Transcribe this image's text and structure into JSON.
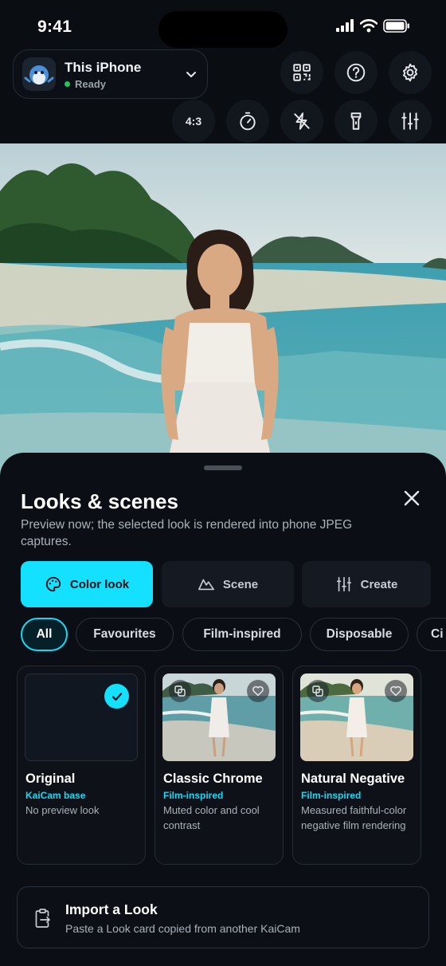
{
  "status": {
    "time": "9:41"
  },
  "device": {
    "name": "This iPhone",
    "status": "Ready"
  },
  "toolbar": {
    "ratio": "4:3"
  },
  "icons": [
    "qr-code-icon",
    "help-icon",
    "gear-icon",
    "timer-icon",
    "flash-off-icon",
    "flashlight-icon",
    "sliders-icon",
    "grid-icon"
  ],
  "sheet": {
    "title": "Looks & scenes",
    "description": "Preview now; the selected look is rendered into phone JPEG captures.",
    "tabs": [
      {
        "label": "Color look",
        "icon": "palette-icon",
        "active": true
      },
      {
        "label": "Scene",
        "icon": "mountain-icon",
        "active": false
      },
      {
        "label": "Create",
        "icon": "sliders-icon",
        "active": false
      }
    ],
    "filters": [
      {
        "label": "All",
        "active": true
      },
      {
        "label": "Favourites",
        "active": false
      },
      {
        "label": "Film-inspired",
        "active": false
      },
      {
        "label": "Disposable",
        "active": false
      },
      {
        "label": "Ci",
        "active": false
      }
    ],
    "cards": [
      {
        "title": "Original",
        "tag": "KaiCam base",
        "description": "No preview look",
        "selected": true
      },
      {
        "title": "Classic Chrome",
        "tag": "Film-inspired",
        "description": "Muted color and cool contrast",
        "selected": false
      },
      {
        "title": "Natural Negative",
        "tag": "Film-inspired",
        "description": "Measured faithful-color negative film rendering",
        "selected": false
      }
    ],
    "import": {
      "title": "Import a Look",
      "description": "Paste a Look card copied from another KaiCam"
    }
  },
  "colors": {
    "accent": "#14e0ff",
    "ready": "#22c55e",
    "background": "#0a0d12"
  }
}
